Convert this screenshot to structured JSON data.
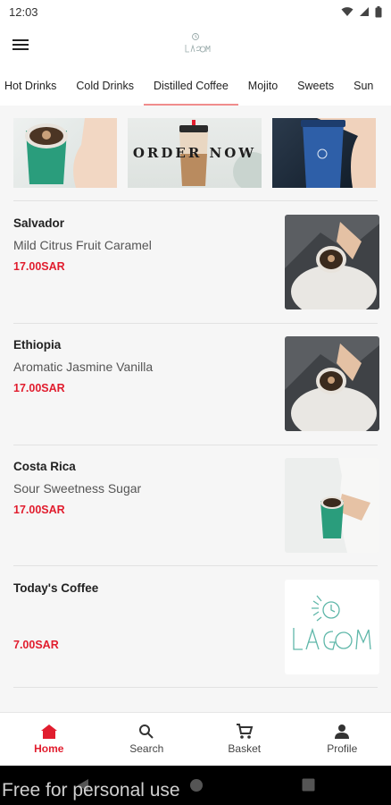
{
  "status_bar": {
    "time": "12:03"
  },
  "header": {
    "logo_text": "lagom"
  },
  "tabs": [
    {
      "label": "Hot Drinks"
    },
    {
      "label": "Cold Drinks"
    },
    {
      "label": "Distilled Coffee",
      "active": true
    },
    {
      "label": "Mojito"
    },
    {
      "label": "Sweets"
    },
    {
      "label": "Sun"
    }
  ],
  "banners": {
    "order_now": "ORDER NOW"
  },
  "products": [
    {
      "name": "Salvador",
      "description": "Mild Citrus Fruit Caramel",
      "price": "17.00SAR"
    },
    {
      "name": "Ethiopia",
      "description": "Aromatic Jasmine Vanilla",
      "price": "17.00SAR"
    },
    {
      "name": "Costa Rica",
      "description": "Sour Sweetness Sugar",
      "price": "17.00SAR"
    },
    {
      "name": "Today's Coffee",
      "description": "",
      "price": "7.00SAR"
    }
  ],
  "product_logo_text": "LAGOM",
  "bottom_nav": [
    {
      "label": "Home",
      "icon": "home-icon",
      "active": true
    },
    {
      "label": "Search",
      "icon": "search-icon"
    },
    {
      "label": "Basket",
      "icon": "cart-icon"
    },
    {
      "label": "Profile",
      "icon": "person-icon"
    }
  ],
  "watermark": "Free for personal use",
  "colors": {
    "accent": "#e11d2e",
    "tab_indicator": "#f08c8c",
    "cup_green": "#2a9d7c",
    "cup_blue": "#2e5fa8"
  }
}
